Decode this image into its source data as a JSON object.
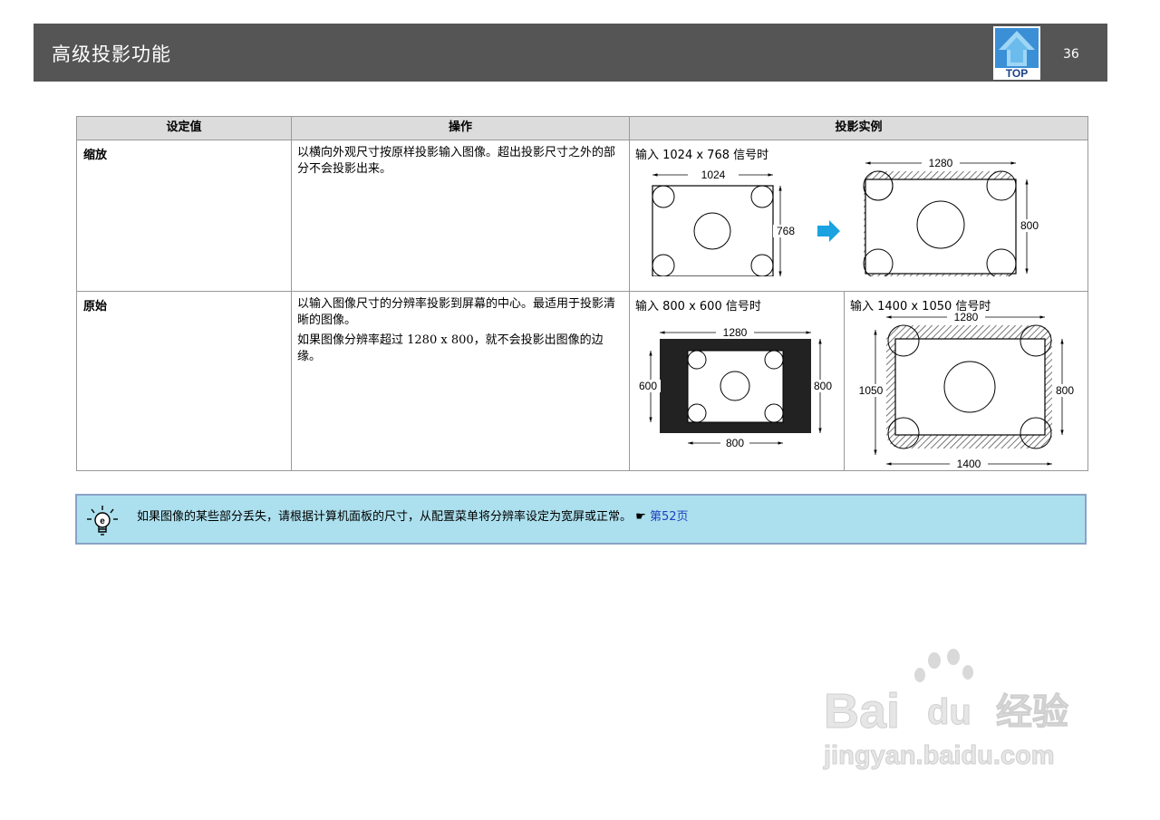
{
  "header": {
    "title": "高级投影功能",
    "top_label": "TOP",
    "page_number": "36"
  },
  "table": {
    "columns": [
      "设定值",
      "操作",
      "投影实例"
    ],
    "rows": [
      {
        "setting": "缩放",
        "operation": [
          "以横向外观尺寸按原样投影输入图像。超出投影尺寸之外的部分不会投影出来。"
        ],
        "example_left": {
          "label": "输入 1024 x 768 信号时",
          "input_width": "1024",
          "input_height": "768",
          "output_width": "1280",
          "output_height": "800"
        }
      },
      {
        "setting": "原始",
        "operation": [
          "以输入图像尺寸的分辨率投影到屏幕的中心。最适用于投影清晰的图像。",
          "如果图像分辨率超过 1280 x 800，就不会投影出图像的边缘。"
        ],
        "example_left": {
          "label": "输入 800 x 600 信号时",
          "screen_width": "1280",
          "screen_height": "800",
          "image_width": "800",
          "image_height": "600"
        },
        "example_right": {
          "label": "输入 1400 x 1050 信号时",
          "screen_width": "1280",
          "screen_height": "800",
          "image_width": "1400",
          "image_height": "1050"
        }
      }
    ]
  },
  "note": {
    "text": "如果图像的某些部分丢失，请根据计算机面板的尺寸，从配置菜单将分辨率设定为宽屏或正常。",
    "pointer": "☛",
    "link": "第52页"
  },
  "watermark": {
    "brand_a": "Bai",
    "brand_b": "du",
    "brand_c": "经验",
    "url": "jingyan.baidu.com"
  },
  "colors": {
    "header_bg": "#555555",
    "arrow": "#1aa3e0",
    "note_bg": "#ace0ee",
    "link": "#1f3fbf"
  }
}
